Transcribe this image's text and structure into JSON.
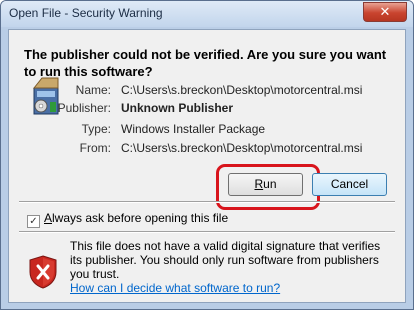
{
  "window": {
    "title": "Open File - Security Warning",
    "close_label": "✕"
  },
  "headline": "The publisher could not be verified.  Are you sure you want to run this software?",
  "details": [
    {
      "label": "Name:",
      "value": "C:\\Users\\s.breckon\\Desktop\\motorcentral.msi",
      "bold": false
    },
    {
      "label": "Publisher:",
      "value": "Unknown Publisher",
      "bold": true
    },
    {
      "label": "Type:",
      "value": "Windows Installer Package",
      "bold": false
    },
    {
      "label": "From:",
      "value": "C:\\Users\\s.breckon\\Desktop\\motorcentral.msi",
      "bold": false
    }
  ],
  "buttons": {
    "run_label_accel": "R",
    "run_label_rest": "un",
    "cancel_label": "Cancel"
  },
  "checkbox": {
    "checked": true,
    "check_glyph": "✓",
    "label_accel": "A",
    "label_rest": "lways ask before opening this file"
  },
  "warning": {
    "text": "This file does not have a valid digital signature that verifies its publisher.  You should only run software from publishers you trust.",
    "link": "How can I decide what software to run?"
  }
}
